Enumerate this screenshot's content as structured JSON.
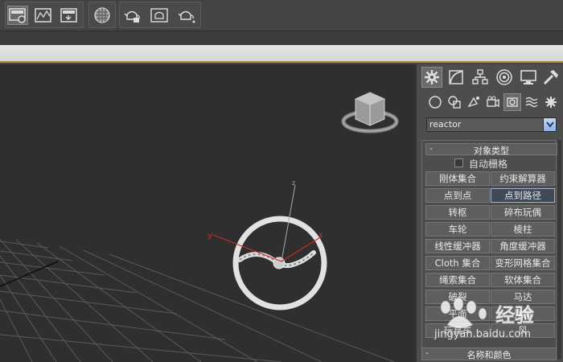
{
  "toolbar": {
    "buttons": [
      {
        "icon": "render-setup-icon"
      },
      {
        "icon": "rendered-frame-icon"
      },
      {
        "icon": "render-production-icon"
      },
      {
        "icon": "material-editor-icon"
      },
      {
        "icon": "render-teapot-icon"
      },
      {
        "icon": "render-frame-window-icon"
      },
      {
        "icon": "quick-render-icon"
      }
    ]
  },
  "viewport": {
    "axis_x": "x",
    "axis_y": "y",
    "axis_z": "z"
  },
  "panel": {
    "tabs": [
      "create-tab",
      "modify-tab",
      "hierarchy-tab",
      "motion-tab",
      "display-tab",
      "utilities-tab"
    ],
    "subtabs": [
      "geometry",
      "shapes",
      "lights",
      "cameras",
      "helpers",
      "space-warps",
      "systems"
    ],
    "dropdown_value": "reactor",
    "rollout_title": "对象类型",
    "rollout_sign": "-",
    "autogrid_label": "自动栅格",
    "buttons": [
      "刚体集合",
      "约束解算器",
      "点到点",
      "点到路径",
      "转枢",
      "碎布玩偶",
      "车轮",
      "棱柱",
      "线性缓冲器",
      "角度缓冲器",
      "Cloth 集合",
      "变形网格集合",
      "绳索集合",
      "软体集合",
      "破裂",
      "马达",
      "平面",
      "弹簧",
      "玩具车",
      "风"
    ],
    "rollout2_title": "名称和颜色",
    "rollout2_sign": "-"
  },
  "watermark": {
    "brand": "经验",
    "url": "jingyan.baidu.com"
  },
  "colors": {
    "viewport_bg": "#2f2f2f",
    "panel_bg": "#4d4d4d",
    "accent_line": "#b08c3a",
    "active_button": "#3e4a58"
  }
}
